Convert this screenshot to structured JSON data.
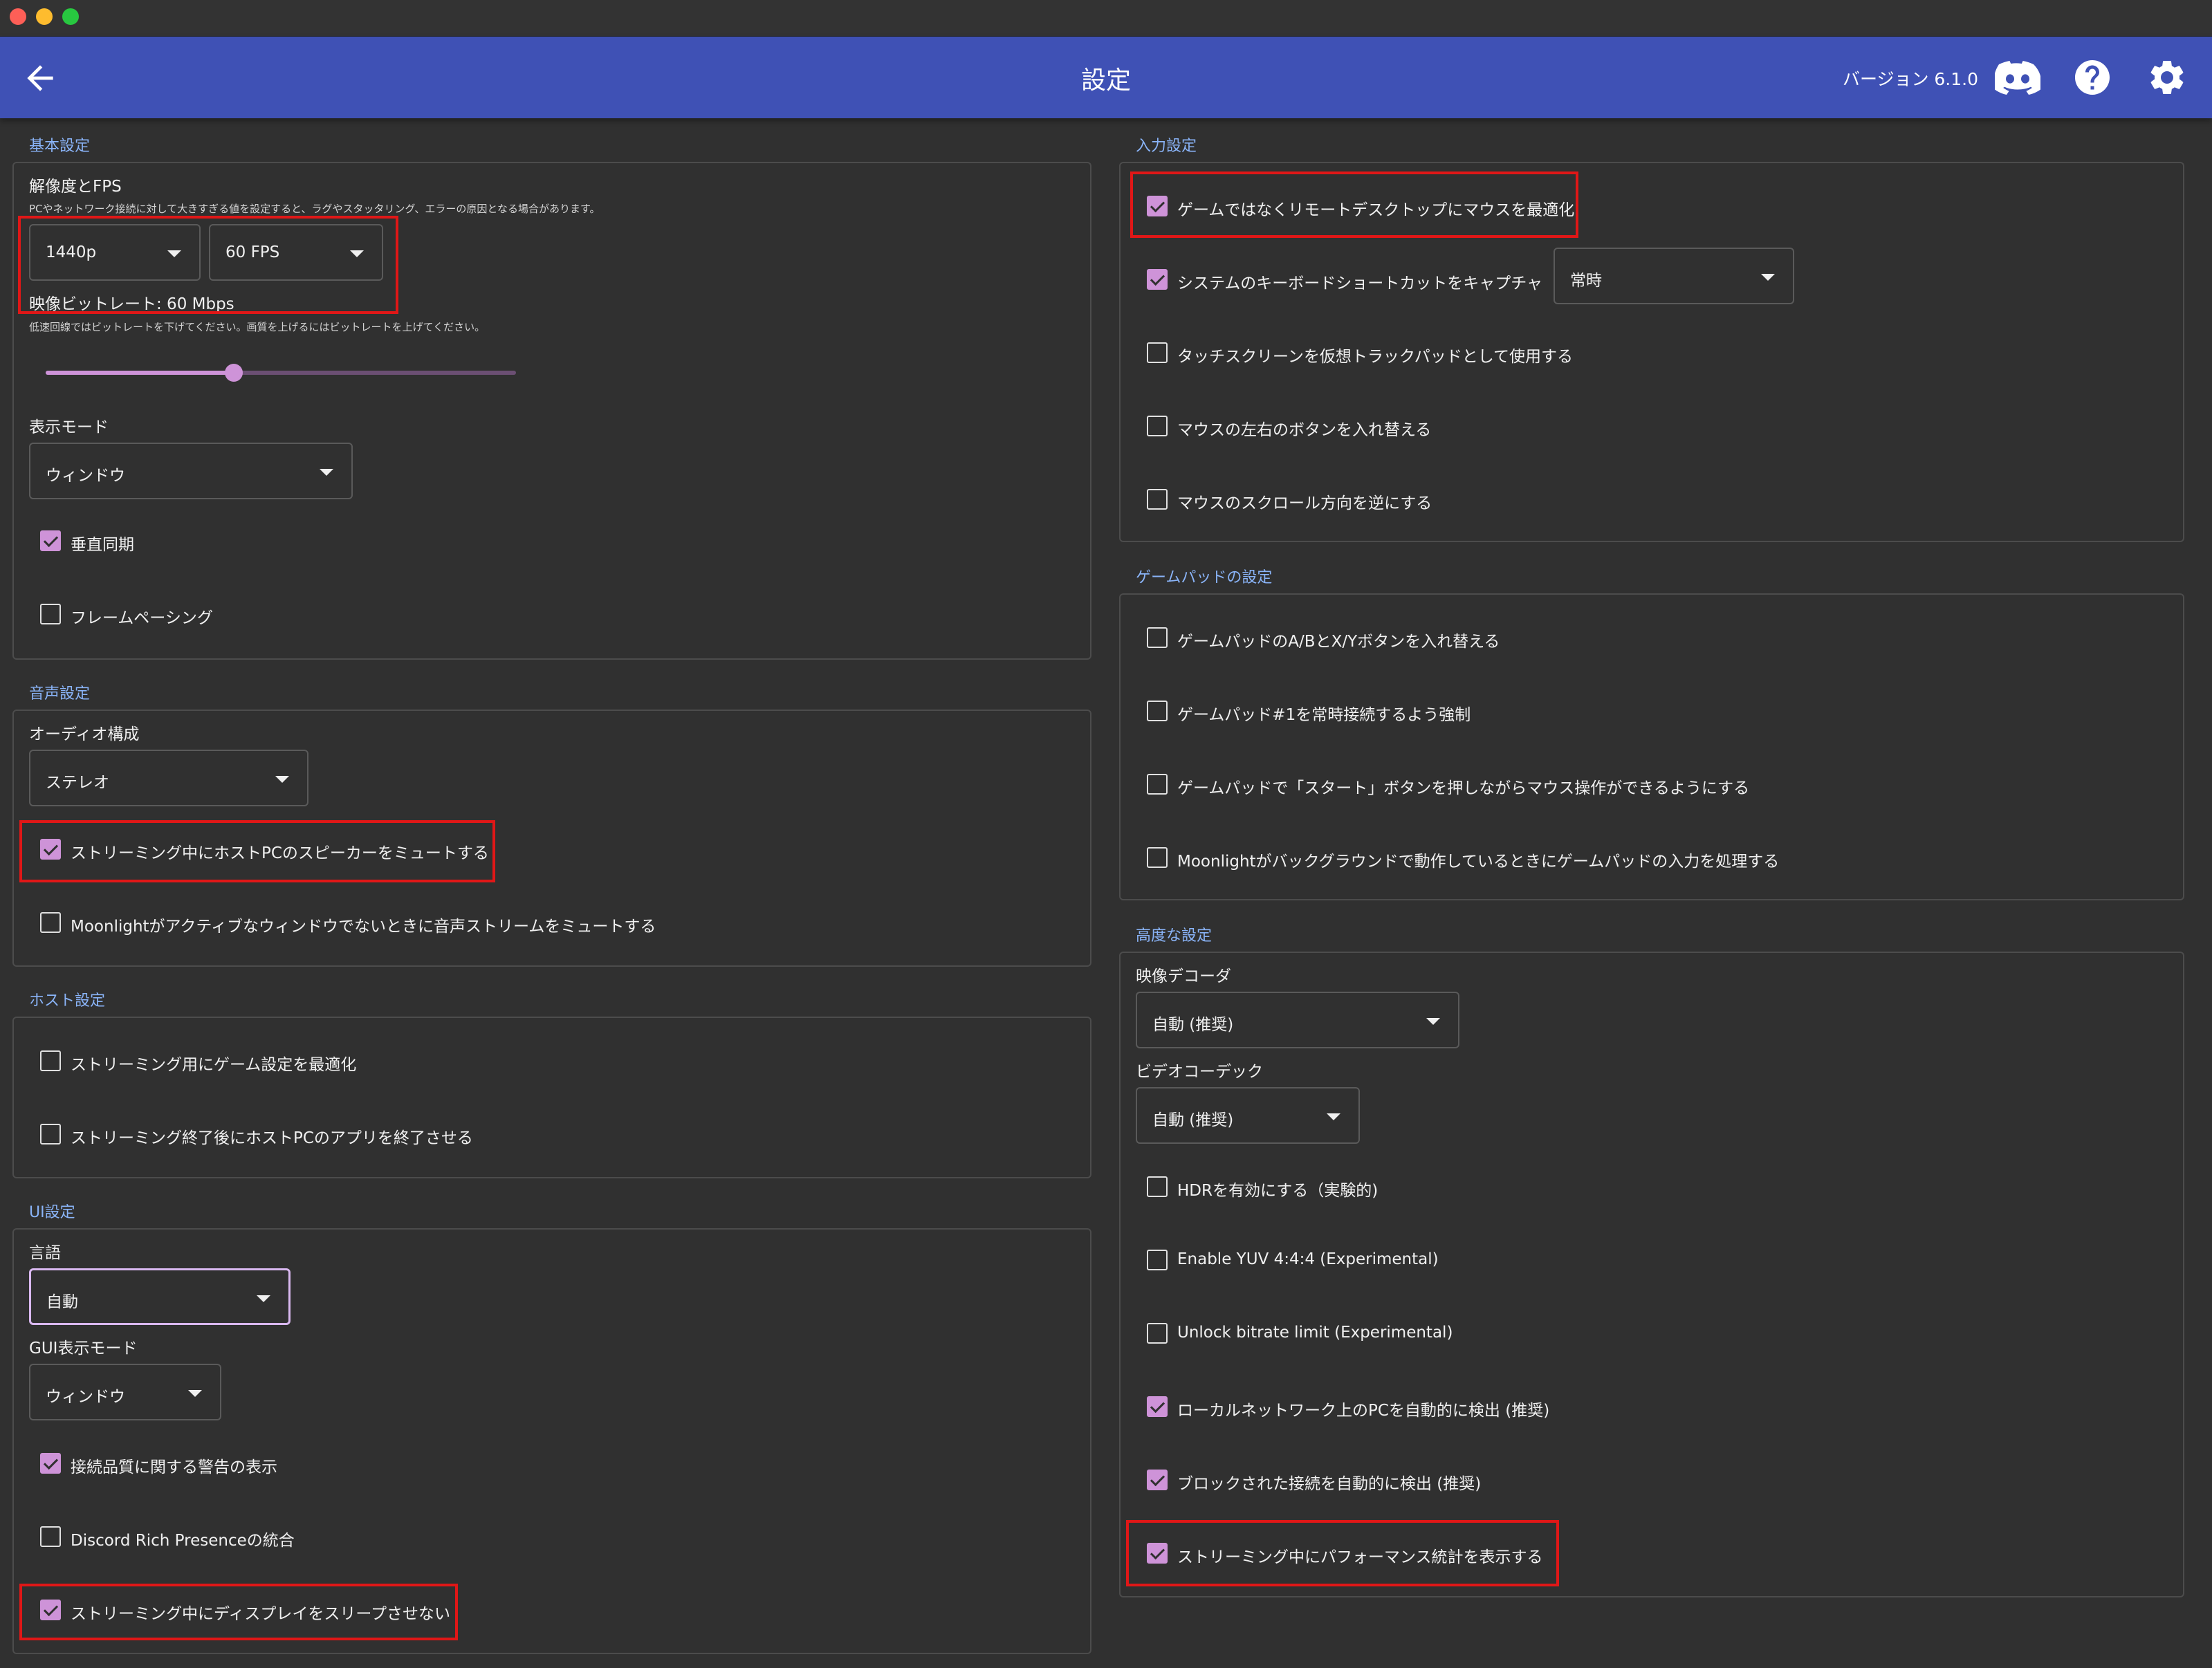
{
  "app": {
    "title": "設定",
    "version": "バージョン 6.1.0",
    "icons": [
      "arrow-back-icon",
      "discord-icon",
      "help-icon",
      "settings-gear-icon"
    ]
  },
  "colors": {
    "appbar": "#3f51b5",
    "accent": "#ce93d8",
    "highlight": "#e01717",
    "section_header": "#8ab4f8",
    "background": "#303030"
  },
  "basic": {
    "section": "基本設定",
    "resfps_label": "解像度とFPS",
    "resfps_hint": "PCやネットワーク接続に対して大きすぎる値を設定すると、ラグやスタッタリング、エラーの原因となる場合があります。",
    "resolution": "1440p",
    "fps": "60 FPS",
    "bitrate_label": "映像ビットレート: 60 Mbps",
    "bitrate_hint": "低速回線ではビットレートを下げてください。画質を上げるにはビットレートを上げてください。",
    "bitrate_slider_fraction": 0.4,
    "display_mode_label": "表示モード",
    "display_mode": "ウィンドウ",
    "vsync": {
      "label": "垂直同期",
      "checked": true
    },
    "frame_pacing": {
      "label": "フレームペーシング",
      "checked": false
    }
  },
  "audio": {
    "section": "音声設定",
    "config_label": "オーディオ構成",
    "config": "ステレオ",
    "mute_host": {
      "label": "ストリーミング中にホストPCのスピーカーをミュートする",
      "checked": true
    },
    "mute_inactive": {
      "label": "Moonlightがアクティブなウィンドウでないときに音声ストリームをミュートする",
      "checked": false
    }
  },
  "host": {
    "section": "ホスト設定",
    "optimize": {
      "label": "ストリーミング用にゲーム設定を最適化",
      "checked": false
    },
    "quit_app": {
      "label": "ストリーミング終了後にホストPCのアプリを終了させる",
      "checked": false
    }
  },
  "ui": {
    "section": "UI設定",
    "language_label": "言語",
    "language": "自動",
    "gui_mode_label": "GUI表示モード",
    "gui_mode": "ウィンドウ",
    "conn_warn": {
      "label": "接続品質に関する警告の表示",
      "checked": true
    },
    "discord": {
      "label": "Discord Rich Presenceの統合",
      "checked": false
    },
    "no_sleep": {
      "label": "ストリーミング中にディスプレイをスリープさせない",
      "checked": true
    }
  },
  "input": {
    "section": "入力設定",
    "remote_mouse": {
      "label": "ゲームではなくリモートデスクトップにマウスを最適化",
      "checked": true
    },
    "capture_shortcuts": {
      "label": "システムのキーボードショートカットをキャプチャ",
      "checked": true
    },
    "capture_mode": "常時",
    "touch_trackpad": {
      "label": "タッチスクリーンを仮想トラックパッドとして使用する",
      "checked": false
    },
    "swap_buttons": {
      "label": "マウスの左右のボタンを入れ替える",
      "checked": false
    },
    "reverse_scroll": {
      "label": "マウスのスクロール方向を逆にする",
      "checked": false
    }
  },
  "gamepad": {
    "section": "ゲームパッドの設定",
    "swap_ab": {
      "label": "ゲームパッドのA/BとX/Yボタンを入れ替える",
      "checked": false
    },
    "force_pad1": {
      "label": "ゲームパッド#1を常時接続するよう強制",
      "checked": false
    },
    "start_mouse": {
      "label": "ゲームパッドで「スタート」ボタンを押しながらマウス操作ができるようにする",
      "checked": false
    },
    "background_input": {
      "label": "Moonlightがバックグラウンドで動作しているときにゲームパッドの入力を処理する",
      "checked": false
    }
  },
  "advanced": {
    "section": "高度な設定",
    "decoder_label": "映像デコーダ",
    "decoder": "自動 (推奨)",
    "codec_label": "ビデオコーデック",
    "codec": "自動 (推奨)",
    "hdr": {
      "label": "HDRを有効にする（実験的)",
      "checked": false
    },
    "yuv444": {
      "label": "Enable YUV 4:4:4 (Experimental)",
      "checked": false
    },
    "unlock_bitrate": {
      "label": "Unlock bitrate limit (Experimental)",
      "checked": false
    },
    "detect_local": {
      "label": "ローカルネットワーク上のPCを自動的に検出 (推奨)",
      "checked": true
    },
    "detect_blocked": {
      "label": "ブロックされた接続を自動的に検出 (推奨)",
      "checked": true
    },
    "perf_overlay": {
      "label": "ストリーミング中にパフォーマンス統計を表示する",
      "checked": true
    }
  }
}
